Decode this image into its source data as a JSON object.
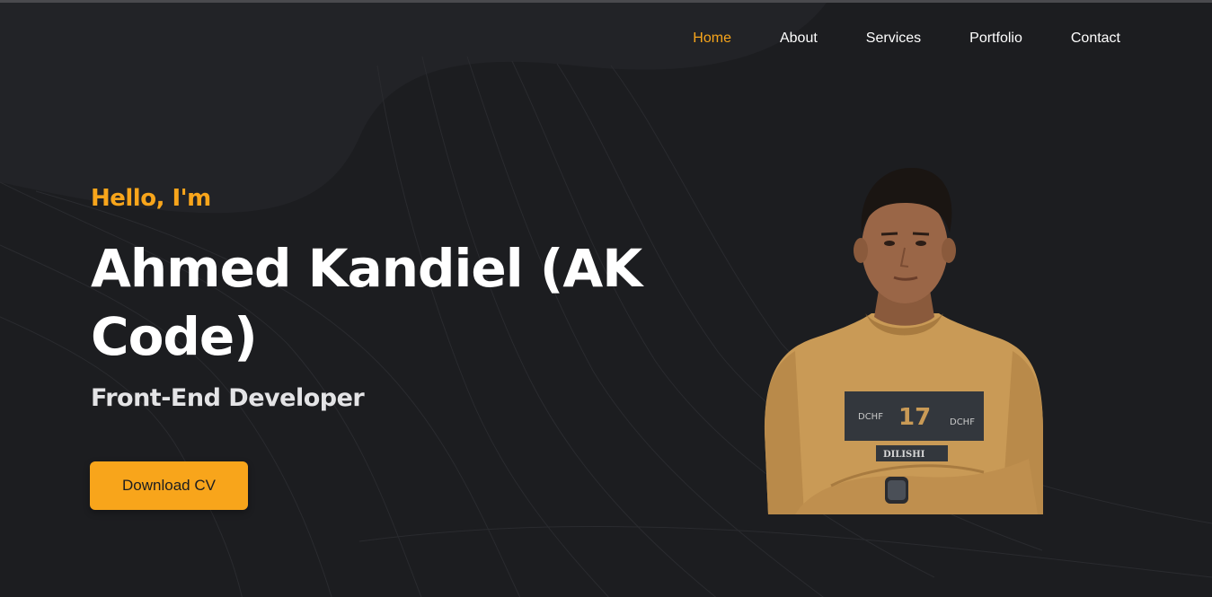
{
  "nav": {
    "items": [
      {
        "label": "Home",
        "active": true
      },
      {
        "label": "About",
        "active": false
      },
      {
        "label": "Services",
        "active": false
      },
      {
        "label": "Portfolio",
        "active": false
      },
      {
        "label": "Contact",
        "active": false
      }
    ]
  },
  "hero": {
    "greeting": "Hello, I'm",
    "name": "Ahmed Kandiel (AK Code)",
    "role": "Front-End Developer",
    "cta_label": "Download CV",
    "shirt_number": "17",
    "shirt_brand": "DCHF",
    "shirt_text": "DILISHI"
  },
  "colors": {
    "accent": "#f8a51b",
    "background": "#1c1d20",
    "text": "#ffffff"
  }
}
